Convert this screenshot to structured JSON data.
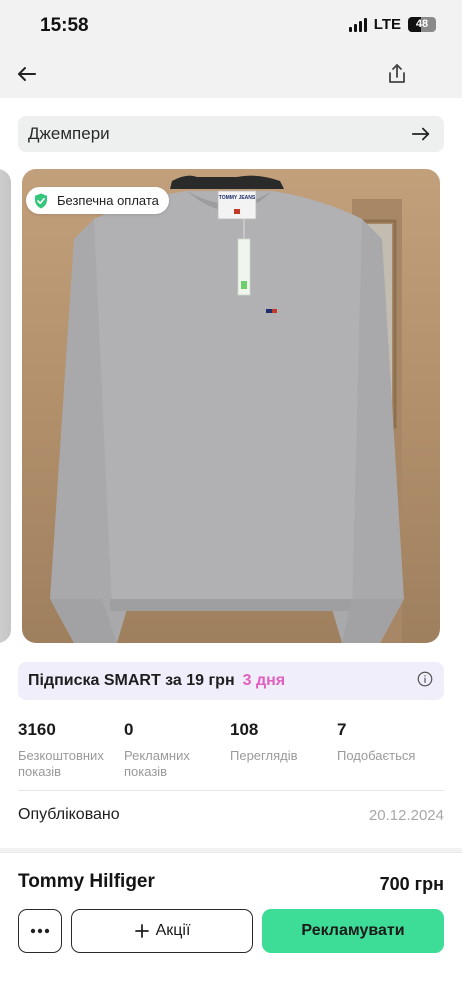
{
  "status_bar": {
    "time": "15:58",
    "network": "LTE",
    "battery": "48",
    "battery_level": 0.48
  },
  "topbar": {
    "back_icon": "arrow-left-icon",
    "share_icon": "share-icon"
  },
  "category": {
    "label": "Джемпери",
    "arrow_icon": "arrow-right-icon"
  },
  "photo": {
    "badge_label": "Безпечна оплата",
    "badge_icon": "shield-check-icon",
    "badge_color": "#34c77b",
    "tag_text": "TOMMY JEANS"
  },
  "promo_banner": {
    "text": "Підписка SMART за 19 грн",
    "highlight": "3 дня",
    "highlight_color": "#e05fc0",
    "info_icon": "info-icon"
  },
  "stats": [
    {
      "value": "3160",
      "label": "Безкоштовних показів"
    },
    {
      "value": "0",
      "label": "Рекламних показів"
    },
    {
      "value": "108",
      "label": "Переглядів"
    },
    {
      "value": "7",
      "label": "Подобається"
    }
  ],
  "published": {
    "label": "Опубліковано",
    "date": "20.12.2024"
  },
  "product": {
    "title": "Tommy Hilfiger",
    "price": "700 грн"
  },
  "actions": {
    "more_icon": "more-horizontal-icon",
    "promo_label": "Акції",
    "promo_icon": "plus-icon",
    "advertise_label": "Рекламувати",
    "advertise_color": "#3ddc97"
  }
}
